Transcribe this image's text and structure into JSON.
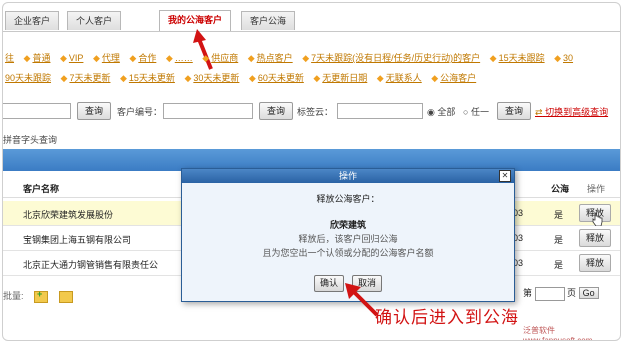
{
  "tabs": [
    {
      "label": "企业客户",
      "active": false
    },
    {
      "label": "个人客户",
      "active": false
    },
    {
      "label": "我的公海客户",
      "active": true
    },
    {
      "label": "客户公海",
      "active": false
    }
  ],
  "filters_row1": [
    "往",
    "普通",
    "VIP",
    "代理",
    "合作",
    "……",
    "供应商",
    "热点客户",
    "7天未跟踪(没有日程/任务/历史行动)的客户",
    "15天未跟踪",
    "30"
  ],
  "filters_row2": [
    "90天未跟踪",
    "7天未更新",
    "15天未更新",
    "30天未更新",
    "60天未更新",
    "无更新日期",
    "无联系人",
    "公海客户"
  ],
  "search": {
    "query_label": "查询",
    "customer_no_label": "客户编号：",
    "query_label2": "查询",
    "tag_cloud_label": "标签云：",
    "radio_all": "全部",
    "radio_any": "任一",
    "query_label3": "查询",
    "advanced_link": "切换到高级查询"
  },
  "pinyin_query": "拼音字头查询",
  "table": {
    "headers": {
      "name": "客户名称",
      "sea": "公海",
      "action": "操作"
    },
    "rows": [
      {
        "name": "北京欣荣建筑发展股份",
        "code": "03",
        "sea": "是",
        "action": "释放"
      },
      {
        "name": "宝钢集团上海五钢有限公司",
        "code": "03",
        "sea": "是",
        "action": "释放"
      },
      {
        "name": "北京正大通力钢管销售有限责任公",
        "code": "03",
        "sea": "是",
        "action": "释放"
      }
    ]
  },
  "batch_label": "批量:",
  "pager": {
    "prefix": "第",
    "suffix": "页",
    "go": "Go"
  },
  "modal": {
    "title": "操作",
    "question": "释放公海客户：",
    "customer": "欣荣建筑",
    "note1": "释放后，该客户回归公海",
    "note2": "且为您空出一个认领或分配的公海客户名额",
    "confirm": "确认",
    "cancel": "取消"
  },
  "annotation": "确认后进入到公海",
  "watermark": "泛普软件 www.fanpusoft.com",
  "colors": {
    "link": "#c07800",
    "band": "#3b7cc4",
    "annotation": "#d21313"
  }
}
